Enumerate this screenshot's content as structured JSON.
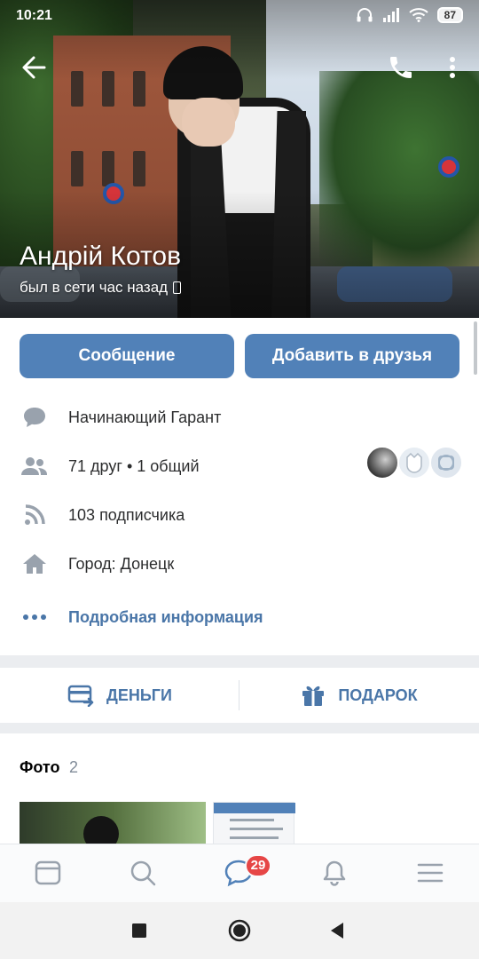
{
  "status_bar": {
    "time": "10:21",
    "battery": "87"
  },
  "profile": {
    "name": "Андрій Котов",
    "last_seen": "был в сети час назад"
  },
  "buttons": {
    "message": "Сообщение",
    "add_friend": "Добавить в друзья"
  },
  "info": {
    "status_text": "Начинающий Гарант",
    "friends_count": "71",
    "friends_word": "друг",
    "separator": " • ",
    "mutual_count": "1",
    "mutual_word": "общий",
    "followers_count": "103",
    "followers_word": "подписчика",
    "city": "Город: Донецк",
    "more_info": "Подробная информация"
  },
  "actions": {
    "money": "ДЕНЬГИ",
    "gift": "ПОДАРОК"
  },
  "photos": {
    "title": "Фото",
    "count": "2"
  },
  "tabbar": {
    "messages_badge": "29",
    "tabs": [
      "news-icon",
      "search-icon",
      "messages-icon",
      "notifications-icon",
      "menu-icon"
    ]
  },
  "colors": {
    "accent": "#5181b8",
    "link": "#4a76a8",
    "badge": "#e64646",
    "background": "#ebedf0"
  }
}
